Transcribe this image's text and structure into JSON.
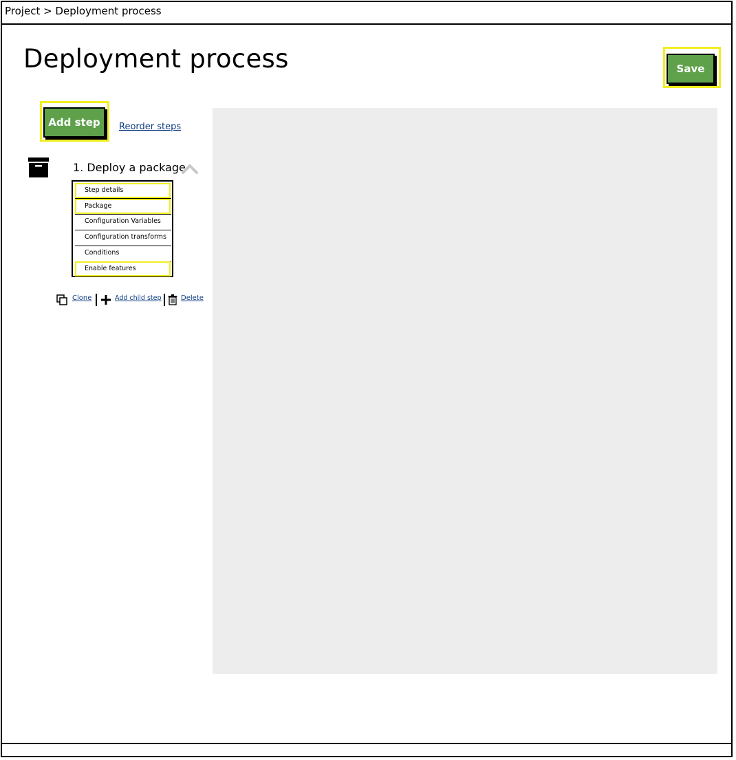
{
  "breadcrumb": "Project > Deployment process",
  "page_title": "Deployment process",
  "toolbar": {
    "save_label": "Save",
    "add_step_label": "Add step",
    "reorder_label": "Reorder steps"
  },
  "step": {
    "title": "1. Deploy a package",
    "icon": "archive-box-icon",
    "menu": [
      {
        "label": "Step details",
        "selected": true
      },
      {
        "label": "Package",
        "selected": true
      },
      {
        "label": "Configuration Variables",
        "selected": false
      },
      {
        "label": "Configuration transforms",
        "selected": false
      },
      {
        "label": "Conditions",
        "selected": false
      },
      {
        "label": "Enable features",
        "selected": true
      }
    ],
    "actions": {
      "clone": "Clone",
      "add_child": "Add child step",
      "delete": "Delete"
    }
  },
  "colors": {
    "button_green": "#5ea14a",
    "highlight_yellow": "#f2ee20",
    "panel_gray": "#ededed",
    "link_blue": "#0a3a82"
  }
}
